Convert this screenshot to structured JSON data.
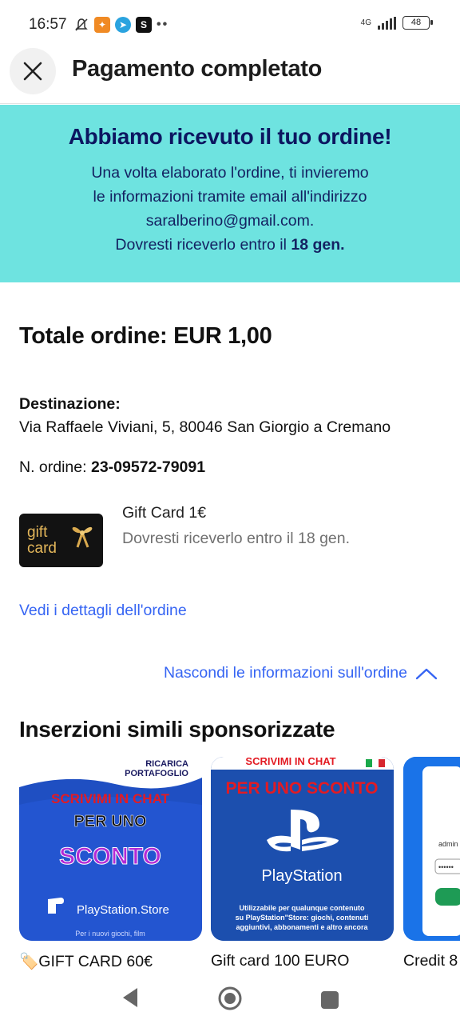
{
  "status_bar": {
    "time": "16:57",
    "network": "4G",
    "battery": "48"
  },
  "header": {
    "title": "Pagamento completato"
  },
  "banner": {
    "title": "Abbiamo ricevuto il tuo ordine!",
    "line1": "Una volta elaborato l'ordine, ti invieremo",
    "line2": "le informazioni tramite email all'indirizzo",
    "email": "saralberino@gmail.com.",
    "eta_prefix": "Dovresti riceverlo entro il ",
    "eta_date": "18 gen."
  },
  "order": {
    "total": "Totale ordine: EUR 1,00",
    "destination_label": "Destinazione:",
    "destination_value": "Via Raffaele Viviani, 5, 80046 San Giorgio a Cremano",
    "number_label": "N. ordine: ",
    "number_value": "23-09572-79091",
    "item": {
      "thumb_line1": "gift",
      "thumb_line2": "card",
      "name": "Gift Card 1€",
      "eta": "Dovresti riceverlo entro il 18 gen."
    },
    "details_link": "Vedi i dettagli dell'ordine",
    "hide_link": "Nascondi le informazioni sull'ordine"
  },
  "sponsored": {
    "title": "Inserzioni simili sponsorizzate",
    "cards": [
      {
        "label": "🏷️GIFT CARD 60€",
        "img_top": "RICARICA",
        "img_top2": "PORTAFOGLIO",
        "img_line1": "SCRIVIMI IN CHAT",
        "img_line2": "PER UNO",
        "img_line3": "SCONTO",
        "img_brand": "PlayStation.Store",
        "img_bottom": "Per i nuovi giochi, film"
      },
      {
        "label": "Gift card 100 EURO",
        "img_top": "SCRIVIMI IN CHAT",
        "img_line1": "PER UNO SCONTO",
        "img_brand": "PlayStation",
        "img_small1": "Utilizzabile per qualunque contenuto",
        "img_small2": "su PlayStation\"Store: giochi, contenuti",
        "img_small3": "aggiuntivi, abbonamenti e altro ancora"
      },
      {
        "label": "Credit 8",
        "img_text1": "admin",
        "img_text2": "••••••"
      }
    ]
  },
  "colors": {
    "banner_bg": "#6ee3e0",
    "link": "#3665f3",
    "banner_text": "#0c1660"
  },
  "icons": {
    "close": "close-icon",
    "chevron": "chevron-up-icon",
    "back": "back-triangle-icon",
    "home": "home-circle-icon",
    "recent": "recent-square-icon"
  }
}
